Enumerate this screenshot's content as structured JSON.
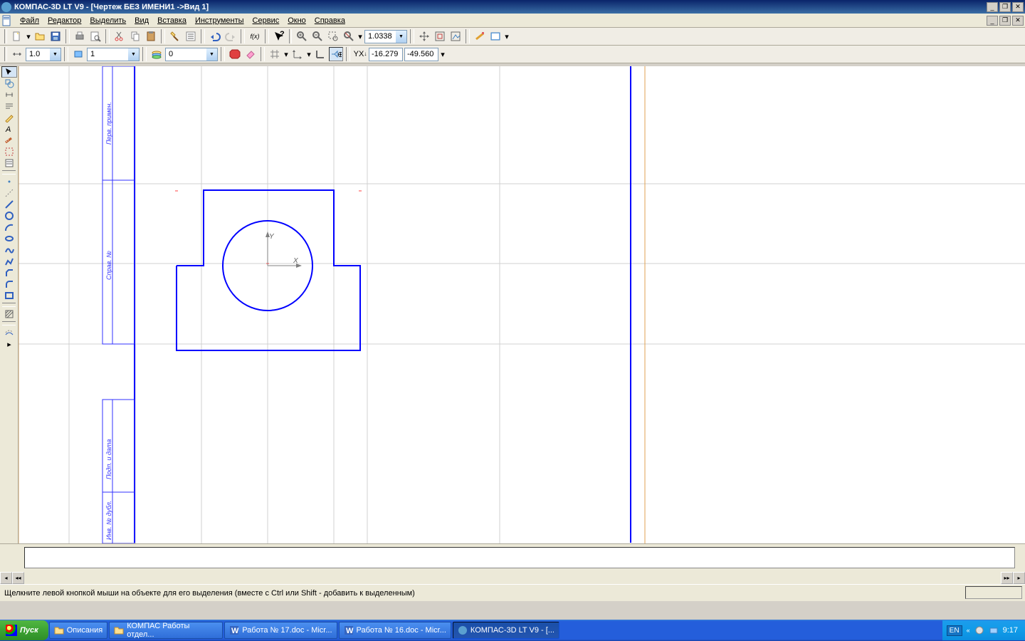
{
  "titlebar": {
    "text": "КОМПАС-3D LT V9 - [Чертеж БЕЗ ИМЕНИ1 ->Вид 1]"
  },
  "menu": {
    "file": "Файл",
    "edit": "Редактор",
    "select": "Выделить",
    "view": "Вид",
    "insert": "Вставка",
    "tools": "Инструменты",
    "service": "Сервис",
    "window": "Окно",
    "help": "Справка"
  },
  "toolbar2": {
    "step": "1.0",
    "zoom": "1.0338",
    "view_no": "1",
    "layer_no": "0",
    "coord_x": "-16.279",
    "coord_y": "-49.560"
  },
  "canvas": {
    "axis_x": "X",
    "axis_y": "Y",
    "title_left_top": "Перв. примен.",
    "title_left_mid": "Справ. №",
    "title_left_bot1": "Подп. и дата",
    "title_left_bot2": "Инв. № дубл."
  },
  "status": {
    "hint": "Щелкните левой кнопкой мыши на объекте для его выделения (вместе с Ctrl или Shift - добавить к выделенным)"
  },
  "taskbar": {
    "start": "Пуск",
    "tasks": [
      {
        "label": "Описания",
        "icon": "folder"
      },
      {
        "label": "КОМПАС Работы отдел...",
        "icon": "folder"
      },
      {
        "label": "Работа № 17.doc - Micr...",
        "icon": "word"
      },
      {
        "label": "Работа № 16.doc - Micr...",
        "icon": "word"
      },
      {
        "label": "КОМПАС-3D LT V9 - [...",
        "icon": "kompas"
      }
    ],
    "lang": "EN",
    "time": "9:17"
  }
}
